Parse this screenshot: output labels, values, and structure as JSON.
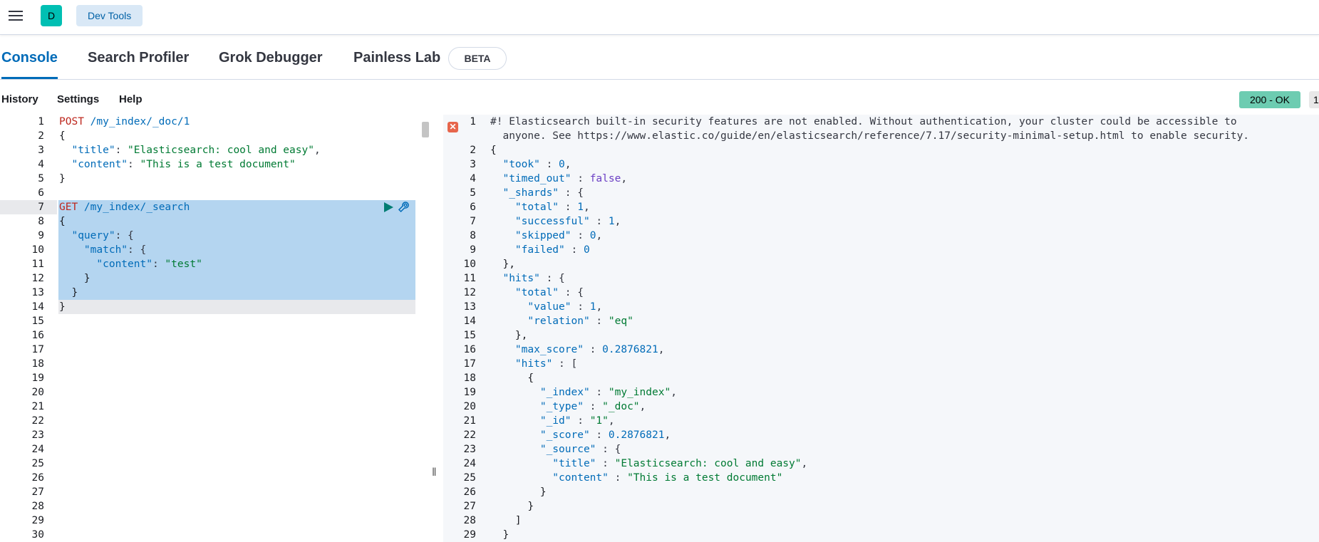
{
  "header": {
    "app_initial": "D",
    "breadcrumb": "Dev Tools"
  },
  "tabs": [
    {
      "label": "Console",
      "active": true
    },
    {
      "label": "Search Profiler"
    },
    {
      "label": "Grok Debugger"
    },
    {
      "label": "Painless Lab"
    }
  ],
  "beta_badge": "BETA",
  "toolbar": {
    "history": "History",
    "settings": "Settings",
    "help": "Help"
  },
  "status": {
    "code": "200 - OK",
    "extra": "1"
  },
  "editor": {
    "line_numbers": [
      "1",
      "2",
      "3",
      "4",
      "5",
      "6",
      "7",
      "8",
      "9",
      "10",
      "11",
      "12",
      "13",
      "14",
      "15",
      "16",
      "17",
      "18",
      "19",
      "20",
      "21",
      "22",
      "23",
      "24",
      "25",
      "26",
      "27",
      "28",
      "29",
      "30"
    ],
    "lines": [
      {
        "method": "POST",
        "path": " /my_index/_doc/1"
      },
      {
        "text": "{"
      },
      {
        "key": "  \"title\"",
        "sep": ": ",
        "val": "\"Elasticsearch: cool and easy\"",
        "tail": ","
      },
      {
        "key": "  \"content\"",
        "sep": ": ",
        "val": "\"This is a test document\"",
        "tail": ""
      },
      {
        "text": "}"
      },
      {
        "text": ""
      },
      {
        "method": "GET",
        "path": " /my_index/_search"
      },
      {
        "text": "{"
      },
      {
        "key": "  \"query\"",
        "sep": ": {",
        "val": "",
        "tail": ""
      },
      {
        "key": "    \"match\"",
        "sep": ": {",
        "val": "",
        "tail": ""
      },
      {
        "key": "      \"content\"",
        "sep": ": ",
        "val": "\"test\"",
        "tail": ""
      },
      {
        "text": "    }"
      },
      {
        "text": "  }"
      },
      {
        "text": "}"
      }
    ]
  },
  "output": {
    "line_numbers": [
      "1",
      "",
      "2",
      "3",
      "4",
      "5",
      "6",
      "7",
      "8",
      "9",
      "10",
      "11",
      "12",
      "13",
      "14",
      "15",
      "16",
      "17",
      "18",
      "19",
      "20",
      "21",
      "22",
      "23",
      "24",
      "25",
      "26",
      "27",
      "28",
      "29"
    ],
    "warning_line1": "#! Elasticsearch built-in security features are not enabled. Without authentication, your cluster could be accessible to",
    "warning_line2": "  anyone. See https://www.elastic.co/guide/en/elasticsearch/reference/7.17/security-minimal-setup.html to enable security.",
    "lines": [
      {
        "text": "{"
      },
      {
        "key": "  \"took\"",
        "sep": " : ",
        "val": "0",
        "type": "n",
        "tail": ","
      },
      {
        "key": "  \"timed_out\"",
        "sep": " : ",
        "val": "false",
        "type": "bool",
        "tail": ","
      },
      {
        "key": "  \"_shards\"",
        "sep": " : {",
        "val": "",
        "type": "n",
        "tail": ""
      },
      {
        "key": "    \"total\"",
        "sep": " : ",
        "val": "1",
        "type": "n",
        "tail": ","
      },
      {
        "key": "    \"successful\"",
        "sep": " : ",
        "val": "1",
        "type": "n",
        "tail": ","
      },
      {
        "key": "    \"skipped\"",
        "sep": " : ",
        "val": "0",
        "type": "n",
        "tail": ","
      },
      {
        "key": "    \"failed\"",
        "sep": " : ",
        "val": "0",
        "type": "n",
        "tail": ""
      },
      {
        "text": "  },"
      },
      {
        "key": "  \"hits\"",
        "sep": " : {",
        "val": "",
        "type": "n",
        "tail": ""
      },
      {
        "key": "    \"total\"",
        "sep": " : {",
        "val": "",
        "type": "n",
        "tail": ""
      },
      {
        "key": "      \"value\"",
        "sep": " : ",
        "val": "1",
        "type": "n",
        "tail": ","
      },
      {
        "key": "      \"relation\"",
        "sep": " : ",
        "val": "\"eq\"",
        "type": "s",
        "tail": ""
      },
      {
        "text": "    },"
      },
      {
        "key": "    \"max_score\"",
        "sep": " : ",
        "val": "0.2876821",
        "type": "n",
        "tail": ","
      },
      {
        "key": "    \"hits\"",
        "sep": " : [",
        "val": "",
        "type": "n",
        "tail": ""
      },
      {
        "text": "      {"
      },
      {
        "key": "        \"_index\"",
        "sep": " : ",
        "val": "\"my_index\"",
        "type": "s",
        "tail": ","
      },
      {
        "key": "        \"_type\"",
        "sep": " : ",
        "val": "\"_doc\"",
        "type": "s",
        "tail": ","
      },
      {
        "key": "        \"_id\"",
        "sep": " : ",
        "val": "\"1\"",
        "type": "s",
        "tail": ","
      },
      {
        "key": "        \"_score\"",
        "sep": " : ",
        "val": "0.2876821",
        "type": "n",
        "tail": ","
      },
      {
        "key": "        \"_source\"",
        "sep": " : {",
        "val": "",
        "type": "n",
        "tail": ""
      },
      {
        "key": "          \"title\"",
        "sep": " : ",
        "val": "\"Elasticsearch: cool and easy\"",
        "type": "s",
        "tail": ","
      },
      {
        "key": "          \"content\"",
        "sep": " : ",
        "val": "\"This is a test document\"",
        "type": "s",
        "tail": ""
      },
      {
        "text": "        }"
      },
      {
        "text": "      }"
      },
      {
        "text": "    ]"
      },
      {
        "text": "  }"
      }
    ]
  },
  "colors": {
    "accent": "#006bb8",
    "selection": "#b4d5f0",
    "status_ok": "#6dccb1"
  },
  "icons": [
    "menu-icon",
    "run-icon",
    "wrench-icon",
    "error-icon"
  ]
}
